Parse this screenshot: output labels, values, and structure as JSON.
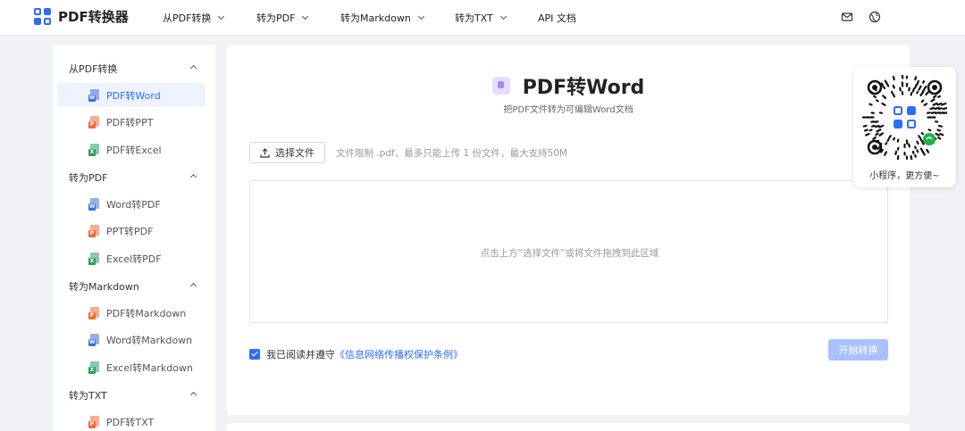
{
  "brand": {
    "name": "PDF转换器",
    "color": "#2f6bff"
  },
  "nav": [
    {
      "label": "从PDF转换",
      "has_dropdown": true
    },
    {
      "label": "转为PDF",
      "has_dropdown": true
    },
    {
      "label": "转为Markdown",
      "has_dropdown": true
    },
    {
      "label": "转为TXT",
      "has_dropdown": true
    },
    {
      "label": "API 文档",
      "has_dropdown": false
    }
  ],
  "nav_icons": [
    "mail-icon",
    "globe-icon"
  ],
  "sidebar": {
    "groups": [
      {
        "title": "从PDF转换",
        "items": [
          {
            "label": "PDF转Word",
            "badge": "W",
            "active": true
          },
          {
            "label": "PDF转PPT",
            "badge": "P",
            "active": false
          },
          {
            "label": "PDF转Excel",
            "badge": "X",
            "active": false
          }
        ]
      },
      {
        "title": "转为PDF",
        "items": [
          {
            "label": "Word转PDF",
            "badge": "W",
            "active": false
          },
          {
            "label": "PPT转PDF",
            "badge": "P",
            "active": false
          },
          {
            "label": "Excel转PDF",
            "badge": "X",
            "active": false
          }
        ]
      },
      {
        "title": "转为Markdown",
        "items": [
          {
            "label": "PDF转Markdown",
            "badge": "P",
            "active": false
          },
          {
            "label": "Word转Markdown",
            "badge": "W",
            "active": false
          },
          {
            "label": "Excel转Markdown",
            "badge": "X",
            "active": false
          }
        ]
      },
      {
        "title": "转为TXT",
        "items": [
          {
            "label": "PDF转TXT",
            "badge": "P",
            "active": false
          }
        ]
      }
    ]
  },
  "colors": {
    "word": "#3d6fdc",
    "ppt": "#f0693a",
    "excel": "#2e9e5b",
    "disabled_button": "#a9c1ff"
  },
  "main": {
    "title": "PDF转Word",
    "subtitle": "把PDF文件转为可编辑Word文档",
    "upload_label": "选择文件",
    "limit_text": "文件限制 .pdf，最多只能上传 1 份文件，最大支持50M",
    "drop_text": "点击上方“选择文件”或将文件拖拽到此区域",
    "agree_prefix": "我已阅读并遵守",
    "agree_link": "《信息网络传播权保护条例》",
    "agree_checked": true,
    "start_label": "开始转换"
  },
  "qr": {
    "caption": "小程序，更方便~"
  }
}
